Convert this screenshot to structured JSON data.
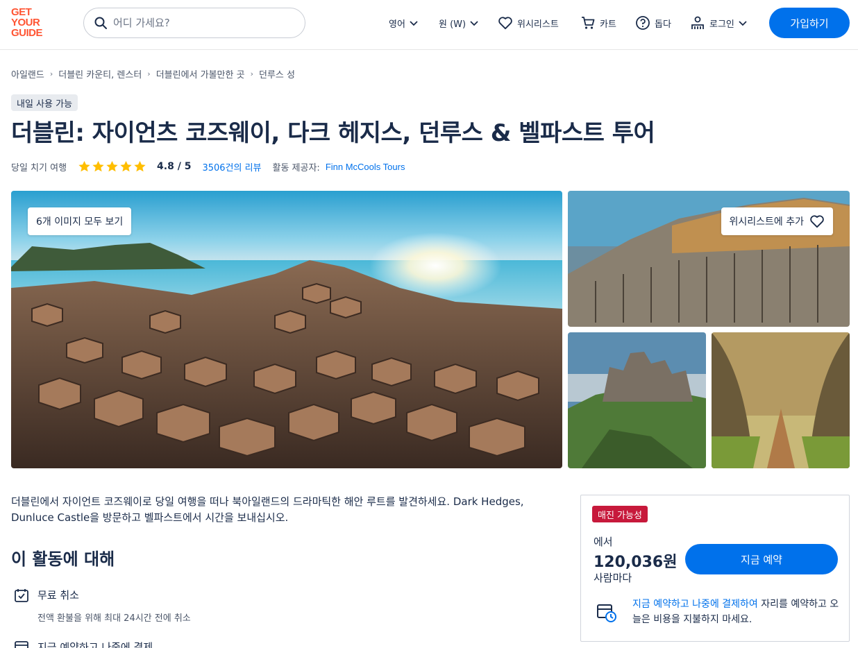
{
  "header": {
    "logo": [
      "GET",
      "YOUR",
      "GUIDE"
    ],
    "search_placeholder": "어디 가세요?",
    "language": "영어",
    "currency": "원 (W)",
    "wishlist": "위시리스트",
    "cart": "카트",
    "help": "돕다",
    "login": "로그인",
    "signup": "가입하기"
  },
  "breadcrumb": [
    "아일랜드",
    "더블린 카운티, 렌스터",
    "더블린에서 가볼만한 곳",
    "던루스 성"
  ],
  "badge": "내일 사용 가능",
  "title": "더블린: 자이언츠 코즈웨이, 다크 헤지스, 던루스 & 벨파스트 투어",
  "meta": {
    "category": "당일 치기 여행",
    "stars": 5,
    "rating": "4.8 / 5",
    "reviews": "3506건의 리뷰",
    "provider_label": "활동 제공자:",
    "provider": "Finn McCools Tours"
  },
  "gallery": {
    "all_images": "6개 이미지 모두 보기",
    "add_wishlist": "위시리스트에 추가"
  },
  "description": "더블린에서 자이언트 코즈웨이로 당일 여행을 떠나 북아일랜드의 드라마틱한 해안 루트를 발견하세요. Dark Hedges, Dunluce Castle을 방문하고 벨파스트에서 시간을 보내십시오.",
  "about": {
    "title": "이 활동에 대해",
    "features": [
      {
        "title": "무료 취소",
        "sub": "전액 환불을 위해 최대 24시간 전에 취소"
      },
      {
        "title": "지금 예약하고 나중에 결제",
        "sub": ""
      }
    ]
  },
  "booking": {
    "availability": "매진 가능성",
    "from": "에서",
    "price": "120,036원",
    "per": "사람마다",
    "book": "지금 예약",
    "rnpl_link": "지금 예약하고 나중에 결제하여",
    "rnpl_rest": " 자리를 예약하고 오늘은 비용을 지불하지 마세요."
  },
  "colors": {
    "brand_blue": "#0071eb",
    "logo_orange": "#ff5533",
    "availability_red": "#c7193b",
    "star": "#ffbe00"
  }
}
